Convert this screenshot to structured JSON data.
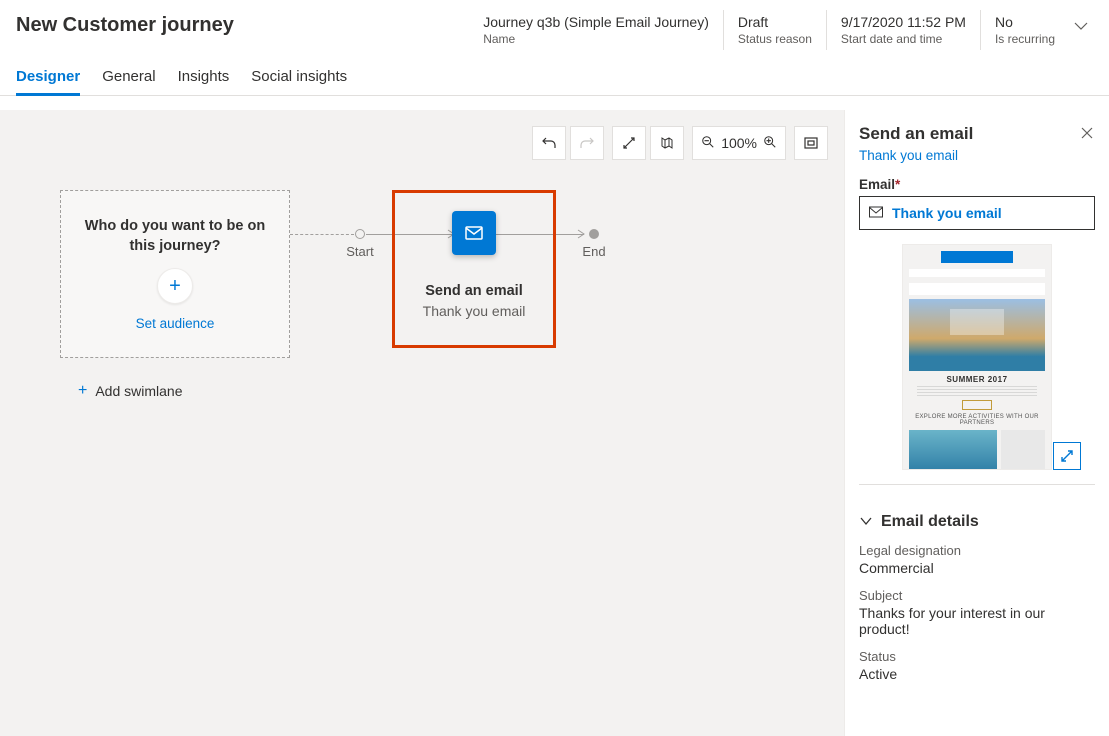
{
  "header": {
    "page_title": "New Customer journey",
    "fields": [
      {
        "value": "Journey q3b (Simple Email Journey)",
        "label": "Name"
      },
      {
        "value": "Draft",
        "label": "Status reason"
      },
      {
        "value": "9/17/2020 11:52 PM",
        "label": "Start date and time"
      },
      {
        "value": "No",
        "label": "Is recurring"
      }
    ]
  },
  "tabs": [
    "Designer",
    "General",
    "Insights",
    "Social insights"
  ],
  "toolbar": {
    "zoom": "100%"
  },
  "canvas": {
    "audience_question": "Who do you want to be on this journey?",
    "set_audience": "Set audience",
    "start_label": "Start",
    "end_label": "End",
    "email_tile": {
      "title": "Send an email",
      "subtitle": "Thank you email"
    },
    "add_swimlane": "Add swimlane"
  },
  "side_panel": {
    "title": "Send an email",
    "subtitle_link": "Thank you email",
    "email_label": "Email",
    "email_value": "Thank you email",
    "preview": {
      "caption": "SUMMER 2017",
      "bar_text": "EXPLORE MORE ACTIVITIES WITH OUR PARTNERS"
    },
    "details": {
      "section_title": "Email details",
      "legal_designation": {
        "label": "Legal designation",
        "value": "Commercial"
      },
      "subject": {
        "label": "Subject",
        "value": "Thanks for your interest in our product!"
      },
      "status": {
        "label": "Status",
        "value": "Active"
      }
    }
  }
}
